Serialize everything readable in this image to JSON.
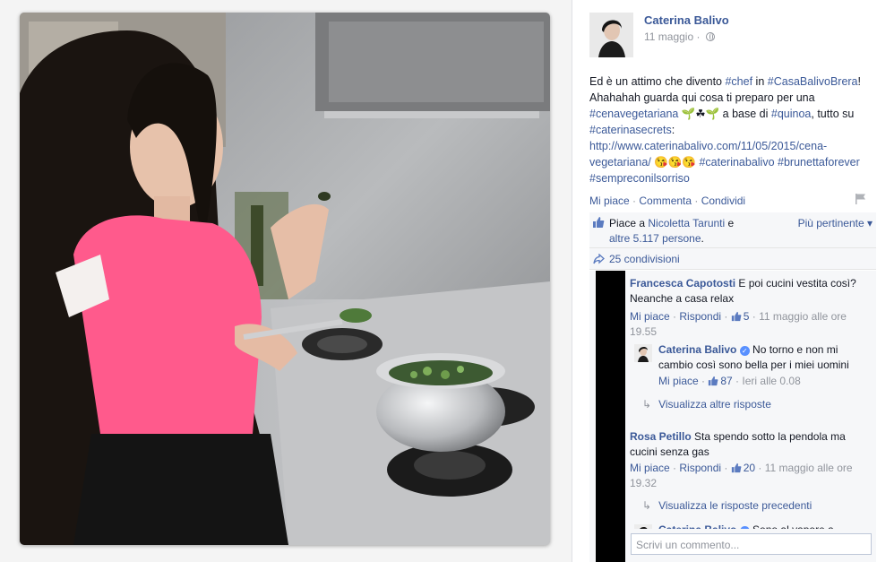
{
  "post": {
    "author": "Caterina Balivo",
    "date": "11 maggio",
    "date_sep": " · ",
    "text_parts": [
      {
        "t": "Ed è un attimo che divento ",
        "tag": false
      },
      {
        "t": "#chef",
        "tag": true
      },
      {
        "t": " in ",
        "tag": false
      },
      {
        "t": "#CasaBalivoBrera",
        "tag": true
      },
      {
        "t": "! Ahahahah guarda qui cosa ti preparo per una ",
        "tag": false
      },
      {
        "t": "#cenavegetariana",
        "tag": true
      },
      {
        "t": " 🌱☘🌱 a base di ",
        "tag": false
      },
      {
        "t": "#quinoa",
        "tag": true
      },
      {
        "t": ", tutto su ",
        "tag": false
      },
      {
        "t": "#caterinasecrets",
        "tag": true
      },
      {
        "t": ": ",
        "tag": false
      },
      {
        "t": "http://www.caterinabalivo.com/11/05/2015/cena-vegetariana/",
        "tag": true
      },
      {
        "t": " 😘😘😘 ",
        "tag": false
      },
      {
        "t": "#caterinabalivo",
        "tag": true
      },
      {
        "t": " ",
        "tag": false
      },
      {
        "t": "#brunettaforever",
        "tag": true
      },
      {
        "t": " ",
        "tag": false
      },
      {
        "t": "#sempreconilsorriso",
        "tag": true
      }
    ]
  },
  "actions": {
    "like": "Mi piace",
    "comment": "Commenta",
    "share": "Condividi",
    "sep": " · "
  },
  "likes": {
    "prefix": "Piace a ",
    "friend": "Nicoletta Tarunti",
    "and": " e ",
    "others": "altre 5.117 persone",
    "end": ".",
    "sort_label": "Più pertinente ▾"
  },
  "shares": {
    "label": "25 condivisioni"
  },
  "comments": [
    {
      "name": "Francesca Capotosti",
      "text": " E poi cucini vestita così? Neanche a casa relax",
      "like": "Mi piace",
      "reply": "Rispondi",
      "count": "5",
      "time": "11 maggio alle ore 19.55"
    },
    {
      "name": "Caterina Balivo",
      "text": " No torno e non mi cambio così sono bella per i miei uomini",
      "like": "Mi piace",
      "count": "87",
      "time": "Ieri alle 0.08"
    },
    {
      "name": "Rosa Petillo",
      "text": " Sta spendo sotto la pendola ma cucini senza gas",
      "like": "Mi piace",
      "reply": "Rispondi",
      "count": "20",
      "time": "11 maggio alle ore 19.32"
    },
    {
      "name": "Caterina Balivo",
      "text": " Sono al vapore a..."
    }
  ],
  "more_replies": "Visualizza altre risposte",
  "previous_replies": "Visualizza le risposte precedenti",
  "write_placeholder": "Scrivi un commento...",
  "colors": {
    "link": "#3b5998",
    "meta": "#90949c",
    "shirt": "#ff5a8c"
  }
}
